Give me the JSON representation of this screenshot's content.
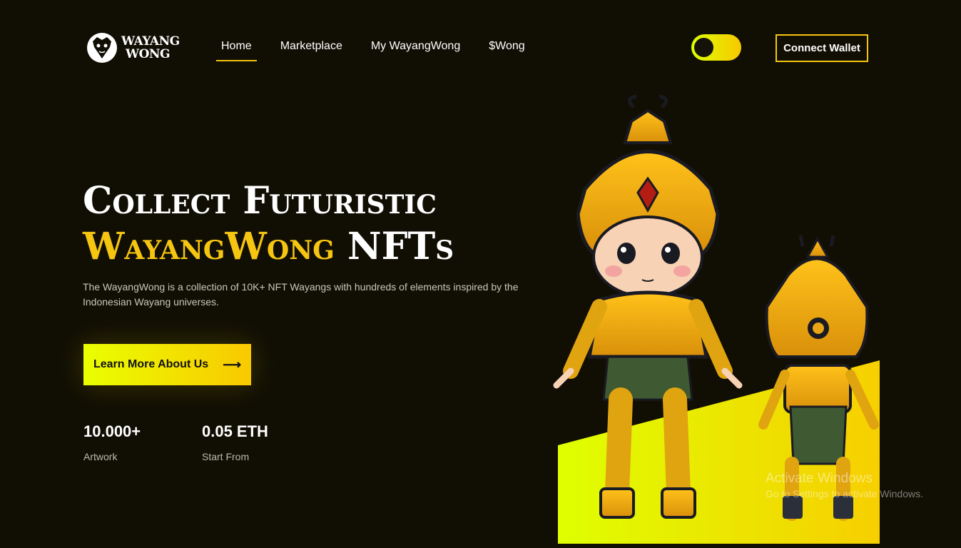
{
  "brand": {
    "line1": "WAYANG",
    "line2": "WONG"
  },
  "nav": {
    "items": [
      {
        "label": "Home",
        "active": true
      },
      {
        "label": "Marketplace"
      },
      {
        "label": "My WayangWong"
      },
      {
        "label": "$Wong"
      }
    ],
    "theme_toggle_icon": "toggle-icon",
    "connect_wallet": "Connect Wallet"
  },
  "hero": {
    "title_line1": "Collect Futuristic",
    "title_accent": "WayangWong",
    "title_rest": " NFTs",
    "description": "The WayangWong is a collection of 10K+ NFT Wayangs with hundreds of elements inspired by the Indonesian Wayang universes.",
    "cta_label": "Learn More About Us",
    "cta_icon": "arrow-right-icon"
  },
  "stats": [
    {
      "value": "10.000+",
      "label": "Artwork"
    },
    {
      "value": "0.05 ETH",
      "label": "Start From"
    }
  ],
  "watermark": {
    "line1": "Activate Windows",
    "line2": "Go to Settings to activate Windows."
  },
  "colors": {
    "background": "#110f04",
    "accent": "#f5c511",
    "accent_gradient_start": "#eaff00",
    "accent_gradient_end": "#f9c900"
  }
}
